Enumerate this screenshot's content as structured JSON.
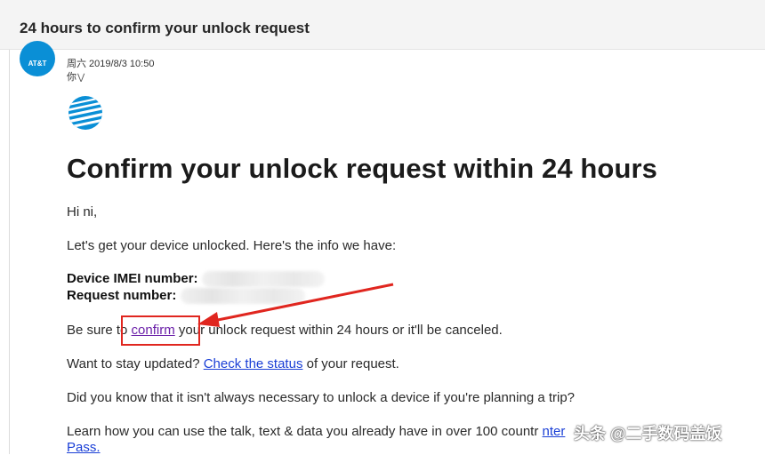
{
  "email": {
    "subject": "24 hours to confirm your unlock request",
    "sender_avatar_text": "AT&T",
    "date": "周六 2019/8/3 10:50",
    "to": "你",
    "to_chevron_icon": "chevron-double-down-icon",
    "logo_icon": "att-globe-logo",
    "heading": "Confirm your unlock request within 24 hours",
    "greeting": "Hi ni,",
    "intro": "Let's get your device unlocked. Here's the info we have:",
    "imei_label": "Device IMEI number:",
    "request_label": "Request number:",
    "confirm_prefix": "Be sure to ",
    "confirm_link": "confirm",
    "confirm_suffix": " your unlock request within 24 hours or it'll be canceled.",
    "status_prefix": "Want to stay updated? ",
    "status_link": "Check the status",
    "status_suffix": " of your request.",
    "trip_text": "Did you know that it isn't always necessary to unlock a device if you're planning a trip?",
    "learn_text": "Learn how you can use the talk, text & data you already have in over 100 countr",
    "learn_link_tail": "nter",
    "pass_link": "Pass."
  },
  "overlay": {
    "watermark": "头条 @二手数码盖饭",
    "annotation_color": "#e0261f"
  }
}
